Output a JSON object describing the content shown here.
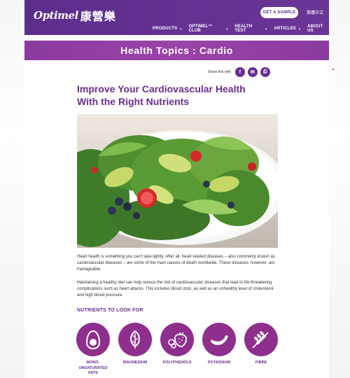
{
  "header": {
    "logo_text": "Optimel",
    "logo_cn": "康營樂",
    "cta_label": "GET A SAMPLE",
    "language_label": "繁體中文",
    "nav": [
      {
        "label": "PRODUCTS",
        "dropdown": true
      },
      {
        "label": "OPTIMEL™ CLUB",
        "dropdown": true
      },
      {
        "label": "HEALTH TEST",
        "dropdown": true
      },
      {
        "label": "ARTICLES",
        "dropdown": true
      },
      {
        "label": "ABOUT US",
        "dropdown": false
      }
    ]
  },
  "topic": {
    "title": "Health Topics : Cardio"
  },
  "share": {
    "label": "Share this with",
    "buttons": [
      {
        "icon": "facebook-icon",
        "glyph": "f"
      },
      {
        "icon": "email-icon",
        "glyph": "✉"
      },
      {
        "icon": "print-icon",
        "glyph": "⎙"
      }
    ]
  },
  "article": {
    "heading_line1": "Improve Your Cardiovascular Health",
    "heading_line2": "With the Right Nutrients",
    "paragraph1": "Heart health is something you can't take lightly. After all, heart-related diseases – also commonly known as cardiovascular diseases – are some of the main causes of death worldwide. These diseases, however, are manageable.",
    "paragraph2": "Maintaining a healthy diet can help reduce the risk of cardiovascular diseases that lead to life-threatening complications such as heart attacks. This includes blood clots, as well as an unhealthy level of cholesterol and high blood pressure."
  },
  "nutrients": {
    "title": "NUTRIENTS TO LOOK FOR",
    "items": [
      {
        "label_line1": "MONO-",
        "label_line2": "UNSATURATED",
        "label_line3": "FATS",
        "icon": "avocado-icon"
      },
      {
        "label_line1": "MAGNESIUM",
        "label_line2": "",
        "label_line3": "",
        "icon": "spinach-leaf-icon"
      },
      {
        "label_line1": "POLYPHENOLS",
        "label_line2": "",
        "label_line3": "",
        "icon": "berries-icon"
      },
      {
        "label_line1": "POTASSIUM",
        "label_line2": "",
        "label_line3": "",
        "icon": "banana-icon"
      },
      {
        "label_line1": "FIBRE",
        "label_line2": "",
        "label_line3": "",
        "icon": "wheat-icon"
      }
    ]
  },
  "colors": {
    "brand_purple": "#5c2e8c",
    "accent_purple": "#8e2f8e",
    "heading_purple": "#6a2e8f"
  }
}
